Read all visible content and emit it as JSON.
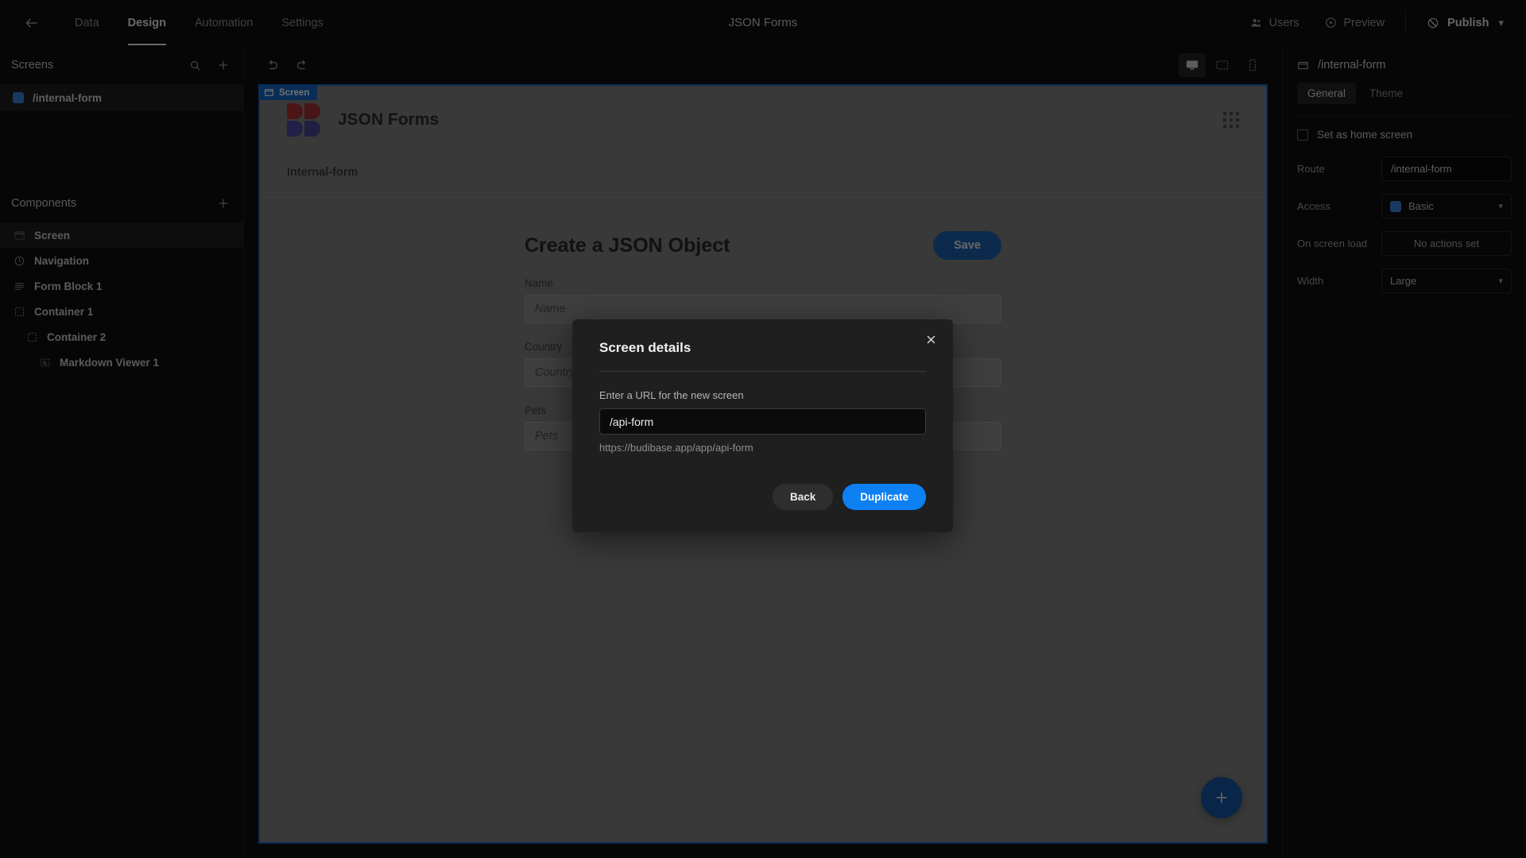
{
  "header": {
    "back_icon": "arrow-left-icon",
    "tabs": [
      {
        "label": "Data",
        "active": false
      },
      {
        "label": "Design",
        "active": true
      },
      {
        "label": "Automation",
        "active": false
      },
      {
        "label": "Settings",
        "active": false
      }
    ],
    "app_title": "JSON Forms",
    "users_label": "Users",
    "preview_label": "Preview",
    "publish_label": "Publish"
  },
  "sidebar": {
    "screens_panel": {
      "title": "Screens",
      "items": [
        {
          "label": "/internal-form",
          "selected": true
        }
      ]
    },
    "components_panel": {
      "title": "Components",
      "items": [
        {
          "label": "Screen",
          "icon": "screen-icon",
          "indent": 0,
          "selected": true
        },
        {
          "label": "Navigation",
          "icon": "navigation-icon",
          "indent": 0,
          "selected": false
        },
        {
          "label": "Form Block 1",
          "icon": "form-block-icon",
          "indent": 0,
          "selected": false
        },
        {
          "label": "Container 1",
          "icon": "container-icon",
          "indent": 0,
          "selected": false
        },
        {
          "label": "Container 2",
          "icon": "container-icon",
          "indent": 1,
          "selected": false
        },
        {
          "label": "Markdown Viewer 1",
          "icon": "markdown-viewer-icon",
          "indent": 2,
          "selected": false
        }
      ]
    }
  },
  "canvas": {
    "toolbar": {
      "undo_icon": "undo-icon",
      "redo_icon": "redo-icon",
      "devices": [
        {
          "name": "desktop",
          "active": true
        },
        {
          "name": "tablet",
          "active": false
        },
        {
          "name": "mobile",
          "active": false
        }
      ]
    },
    "screen_badge": "Screen",
    "app_brand": "JSON Forms",
    "breadcrumb": "Internal-form",
    "form": {
      "title": "Create a JSON Object",
      "save_label": "Save",
      "fields": [
        {
          "label": "Name",
          "placeholder": "Name",
          "value": ""
        },
        {
          "label": "Country",
          "placeholder": "Country",
          "value": ""
        },
        {
          "label": "Pets",
          "placeholder": "Pets",
          "value": ""
        }
      ]
    },
    "fab_label": "+"
  },
  "properties": {
    "title": "/internal-form",
    "tabs": [
      {
        "label": "General",
        "active": true
      },
      {
        "label": "Theme",
        "active": false
      }
    ],
    "home_screen_label": "Set as home screen",
    "home_screen_checked": false,
    "rows": [
      {
        "label": "Route",
        "value": "/internal-form",
        "kind": "input"
      },
      {
        "label": "Access",
        "value": "Basic",
        "kind": "select-role"
      },
      {
        "label": "On screen load",
        "value": "No actions set",
        "kind": "button"
      },
      {
        "label": "Width",
        "value": "Large",
        "kind": "select"
      }
    ]
  },
  "modal": {
    "title": "Screen details",
    "close_icon": "close-icon",
    "url_label": "Enter a URL for the new screen",
    "url_value": "/api-form",
    "url_help": "https://budibase.app/app/api-form",
    "back_label": "Back",
    "duplicate_label": "Duplicate"
  },
  "colors": {
    "accent_blue": "#0d80f2",
    "canvas_border": "#1565c0",
    "panel_bg": "#0f0f0f",
    "canvas_bg": "#7f7f7f"
  }
}
